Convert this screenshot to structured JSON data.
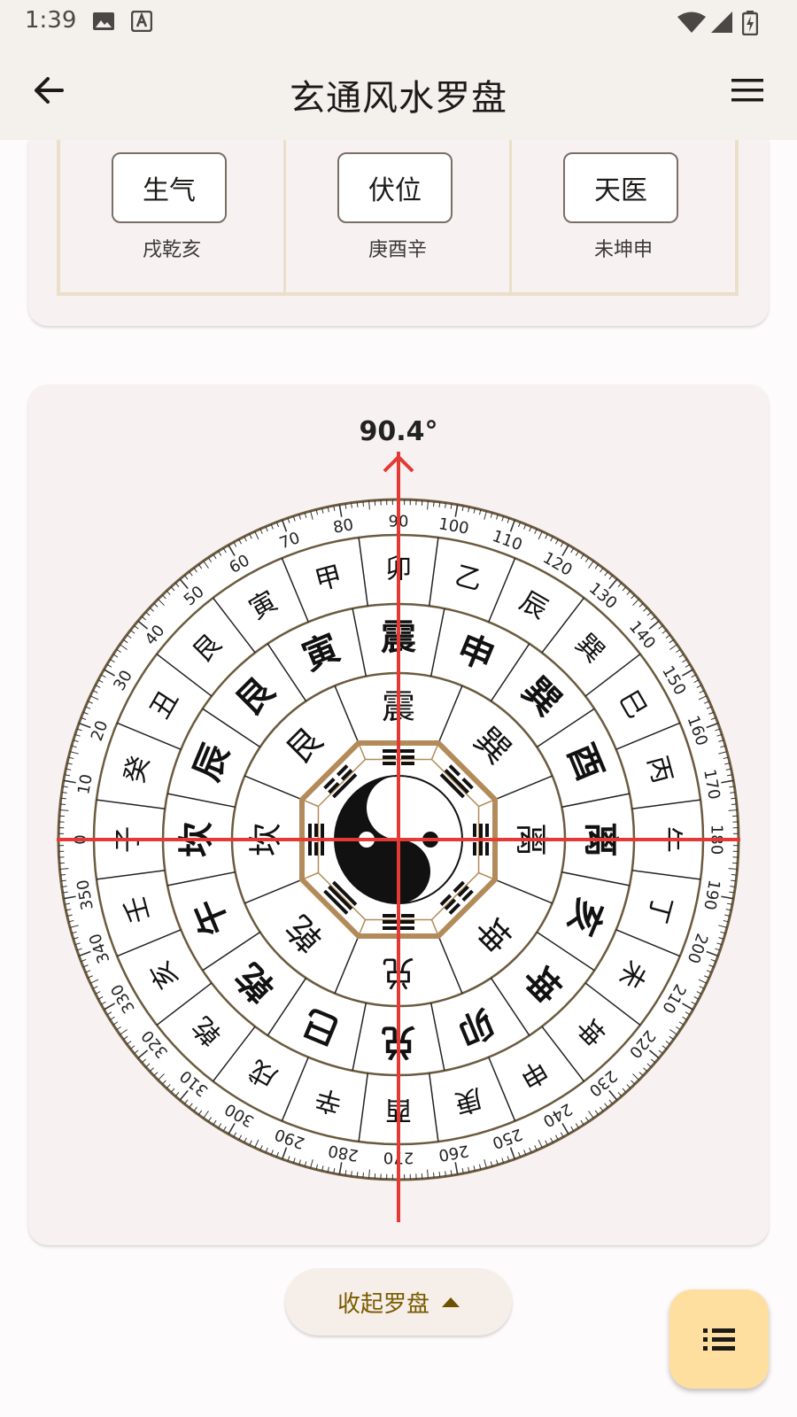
{
  "status_bar": {
    "time": "1:39"
  },
  "app_bar": {
    "title": "玄通风水罗盘"
  },
  "directions": [
    {
      "star": "生气",
      "mountains": "戌乾亥"
    },
    {
      "star": "伏位",
      "mountains": "庚酉辛"
    },
    {
      "star": "天医",
      "mountains": "未坤申"
    }
  ],
  "compass": {
    "heading": "90.4°",
    "heading_value": 90.4,
    "ring24": [
      "子",
      "癸",
      "丑",
      "艮",
      "寅",
      "甲",
      "卯",
      "乙",
      "辰",
      "巽",
      "巳",
      "丙",
      "午",
      "丁",
      "未",
      "坤",
      "申",
      "庚",
      "酉",
      "辛",
      "戌",
      "乾",
      "亥",
      "壬"
    ],
    "ring12": [
      "坎",
      "辰",
      "艮",
      "寅",
      "震",
      "申",
      "巽",
      "酉",
      "离",
      "亥",
      "坤",
      "卯",
      "兑",
      "巳",
      "乾",
      "午"
    ],
    "ring8": [
      "坎",
      "艮",
      "震",
      "巽",
      "离",
      "坤",
      "兑",
      "乾"
    ],
    "degree_labels": [
      "0",
      "10",
      "20",
      "30",
      "40",
      "50",
      "60",
      "70",
      "80",
      "90",
      "100",
      "110",
      "120",
      "130",
      "140",
      "150",
      "160",
      "170",
      "180",
      "190",
      "200",
      "210",
      "220",
      "230",
      "240",
      "250",
      "260",
      "270",
      "280",
      "290",
      "300",
      "310",
      "320",
      "330",
      "340",
      "350"
    ]
  },
  "collapse_button": {
    "label": "收起罗盘"
  },
  "colors": {
    "needle": "#e53935",
    "ring": "#6b5a3e",
    "bagua": "#b38b5a",
    "fab": "#ffdf9f"
  },
  "icons": {
    "back": "arrow-left-icon",
    "menu": "hamburger-menu-icon",
    "fab": "list-icon"
  }
}
